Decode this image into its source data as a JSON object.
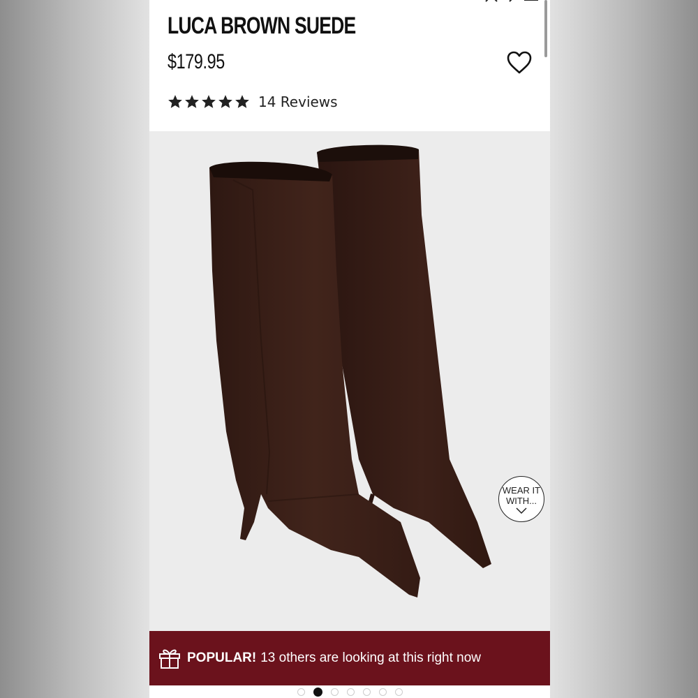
{
  "product": {
    "title": "LUCA BROWN SUEDE",
    "price": "$179.95",
    "rating": {
      "stars": 5,
      "max_stars": 5,
      "reviews_label": "14 Reviews"
    }
  },
  "gallery": {
    "wear_it_line1": "WEAR IT",
    "wear_it_line2": "WITH...",
    "dots_total": 7,
    "active_dot": 2
  },
  "banner": {
    "label": "POPULAR!",
    "text": "13 others are looking at this right now"
  },
  "icons": {
    "wishlist": "heart-icon",
    "gift": "gift-icon",
    "star": "star-icon",
    "chevron": "chevron-down-icon"
  },
  "colors": {
    "banner_bg": "#6b121c",
    "suede": "#3a2018",
    "text": "#111111"
  }
}
